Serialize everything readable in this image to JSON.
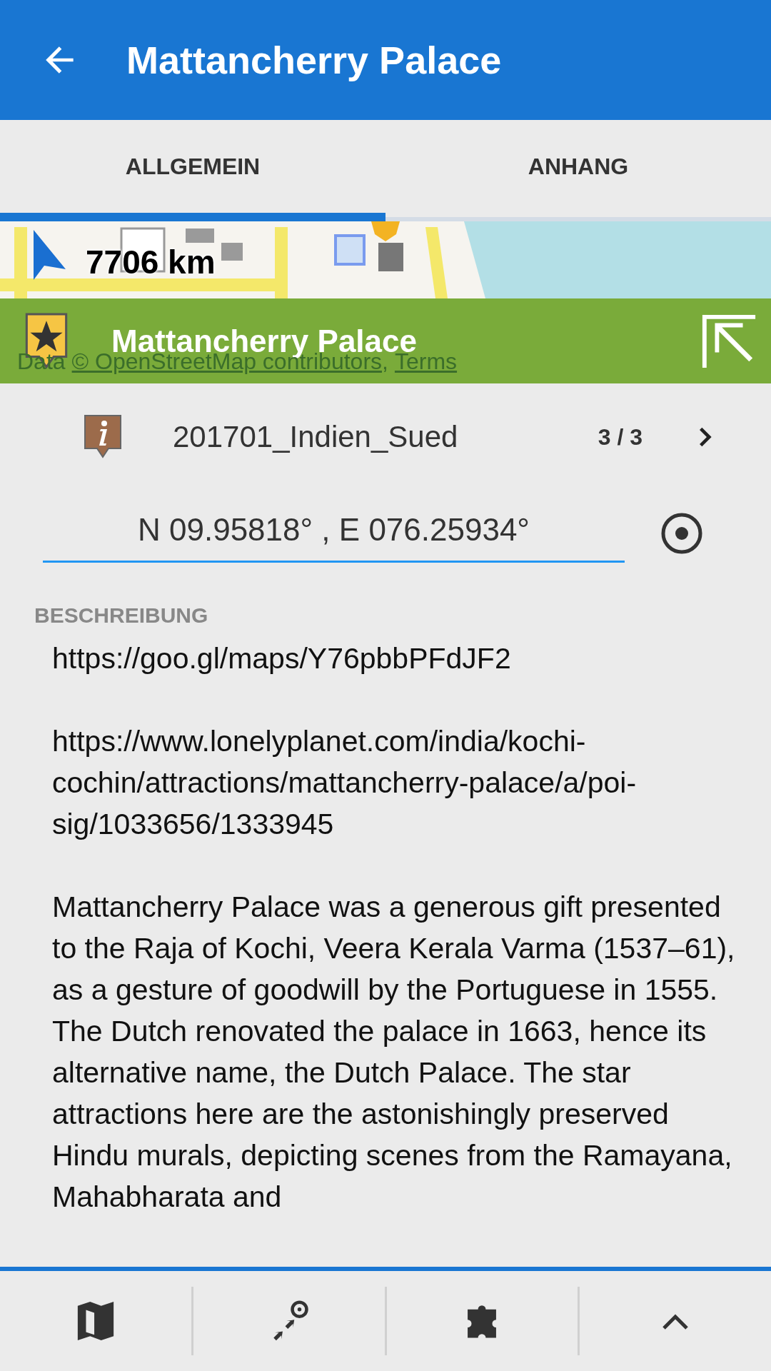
{
  "app_bar": {
    "title": "Mattancherry Palace"
  },
  "tabs": [
    {
      "label": "ALLGEMEIN",
      "selected": true
    },
    {
      "label": "ANHANG",
      "selected": false
    }
  ],
  "map": {
    "distance": "7706 km",
    "attribution": [
      {
        "kind": "text",
        "text": "Data"
      },
      {
        "kind": "link",
        "text": "© OpenStreetMap contributors,"
      },
      {
        "kind": "link",
        "text": "Terms"
      }
    ]
  },
  "point": {
    "name": "Mattancherry Palace"
  },
  "category": {
    "name": "201701_Indien_Sued",
    "position": "3 / 3"
  },
  "coordinates": {
    "value": "N 09.95818° , E 076.25934°"
  },
  "description": {
    "label": "BESCHREIBUNG",
    "paragraphs": [
      "https://goo.gl/maps/Y76pbbPFdJF2",
      "https://www.lonelyplanet.com/india/kochi-cochin/attractions/mattancherry-palace/a/poi-sig/1033656/1333945",
      "Mattancherry Palace was a generous gift presented to the Raja of Kochi, Veera Kerala Varma (1537–61), as a gesture of goodwill by the Portuguese in 1555. The Dutch renovated the palace in 1663, hence its alternative name, the Dutch Palace. The star attractions here are the astonishingly preserved Hindu murals, depicting scenes from the Ramayana, Mahabharata and"
    ]
  }
}
